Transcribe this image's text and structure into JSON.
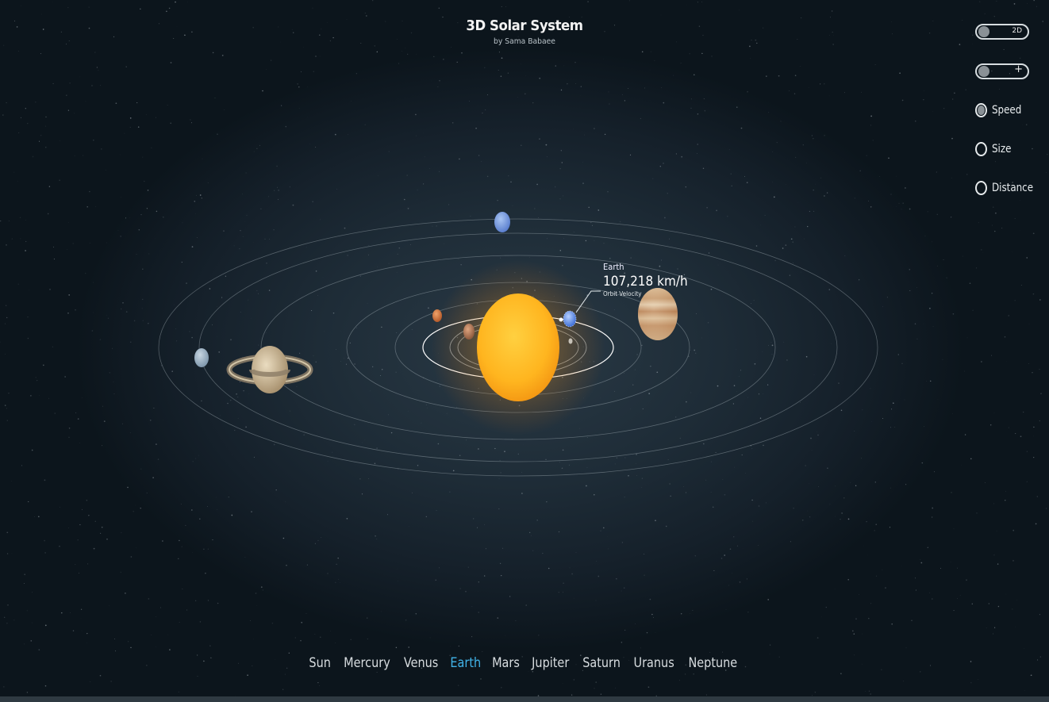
{
  "header": {
    "title": "3D Solar System",
    "author": "by Sama Babaee"
  },
  "controls": {
    "view_toggle_label": "2D",
    "zoom_toggle_label": "+",
    "options": [
      {
        "label": "Speed",
        "checked": true
      },
      {
        "label": "Size",
        "checked": false
      },
      {
        "label": "Distance",
        "checked": false
      }
    ]
  },
  "tooltip": {
    "planet": "Earth",
    "value": "107,218 km/h",
    "caption": "Orbit Velocity"
  },
  "nav": {
    "items": [
      "Sun",
      "Mercury",
      "Venus",
      "Earth",
      "Mars",
      "Jupiter",
      "Saturn",
      "Uranus",
      "Neptune"
    ],
    "active": "Earth"
  },
  "colors": {
    "accent": "#41b3e8",
    "sun": "#ffb51f",
    "background": "#1e2c37"
  }
}
